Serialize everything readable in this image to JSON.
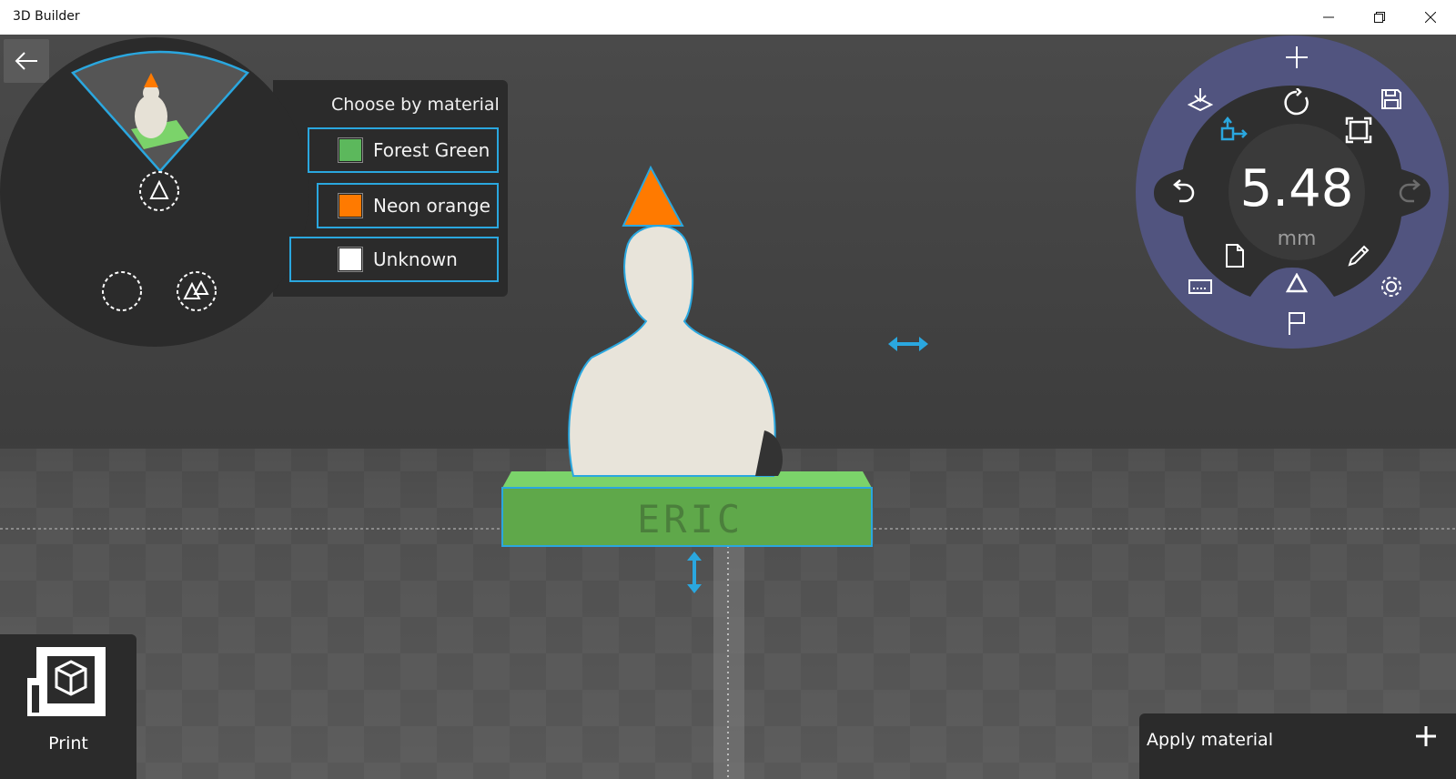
{
  "window": {
    "title": "3D Builder",
    "controls": [
      "minimize-icon",
      "restore-icon",
      "close-icon"
    ]
  },
  "navigation": {
    "back_icon": "back-arrow-icon"
  },
  "selection": {
    "heading": "Choose by material",
    "materials": [
      {
        "label": "Forest Green",
        "color": "#5cb85c"
      },
      {
        "label": "Neon orange",
        "color": "#ff7a00"
      },
      {
        "label": "Unknown",
        "color": "#ffffff"
      }
    ],
    "mode_icons": [
      "select-object-icon",
      "select-volume-icon",
      "select-triangle-icon",
      "select-mesh-icon"
    ]
  },
  "model": {
    "engraved_text": "ERIC",
    "outline_color": "#2aa7df",
    "base_color": "#5fa84a",
    "cone_color": "#ff7a00"
  },
  "control_wheel": {
    "value": "5.48",
    "unit": "mm",
    "icons": [
      "add-icon",
      "drop-to-floor-icon",
      "save-icon",
      "rotate-icon",
      "move-icon",
      "scale-icon",
      "undo-icon",
      "redo-icon",
      "document-icon",
      "pencil-icon",
      "keyboard-icon",
      "triangle-icon",
      "settings-icon",
      "flag-icon"
    ],
    "accent_color": "#51547f"
  },
  "print": {
    "label": "Print",
    "icon": "printer-3d-icon"
  },
  "apply_material": {
    "label": "Apply material",
    "icon": "plus-icon"
  }
}
